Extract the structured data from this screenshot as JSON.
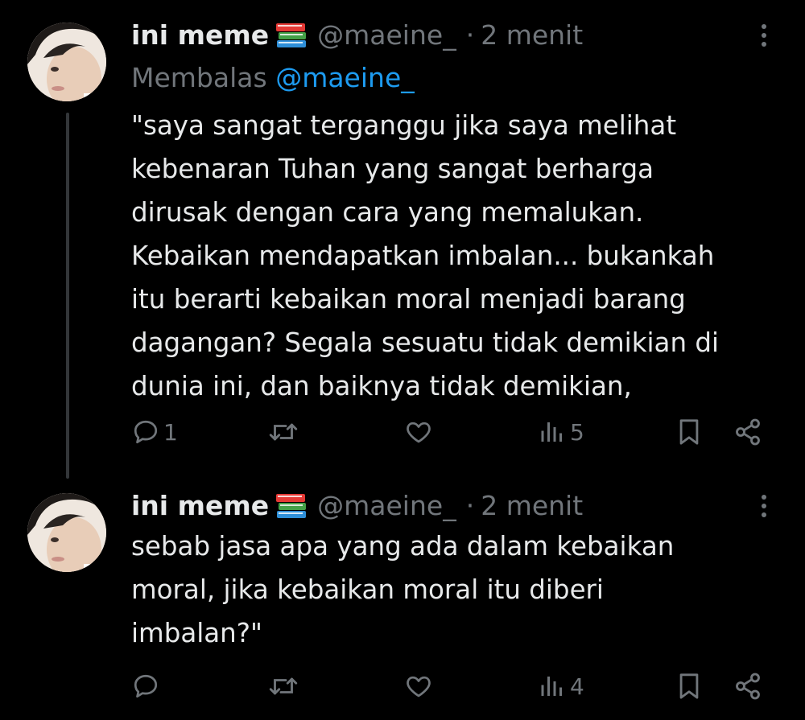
{
  "tweets": [
    {
      "display_name": "ini meme",
      "emoji_icon": "books-icon",
      "handle": "@maeine_",
      "separator": "·",
      "time": "2 menit",
      "reply_prefix": "Membalas",
      "reply_mention": "@maeine_",
      "text": "\"saya sangat terganggu jika saya melihat\nkebenaran Tuhan yang sangat berharga\ndirusak dengan cara yang memalukan.\nKebaikan mendapatkan imbalan... bukankah\nitu berarti kebaikan moral menjadi barang\ndagangan? Segala sesuatu tidak demikian di\ndunia ini, dan baiknya tidak demikian,",
      "actions": {
        "reply_count": "1",
        "retweet_count": "",
        "like_count": "",
        "views_count": "5"
      }
    },
    {
      "display_name": "ini meme",
      "emoji_icon": "books-icon",
      "handle": "@maeine_",
      "separator": "·",
      "time": "2 menit",
      "text": "sebab jasa apa yang ada dalam kebaikan\nmoral, jika kebaikan moral itu diberi\nimbalan?\"",
      "actions": {
        "reply_count": "",
        "retweet_count": "",
        "like_count": "",
        "views_count": "4"
      }
    }
  ],
  "colors": {
    "background": "#000000",
    "text": "#e7e9ea",
    "muted": "#71767b",
    "mention": "#1d9bf0",
    "thread_line": "#333639"
  }
}
